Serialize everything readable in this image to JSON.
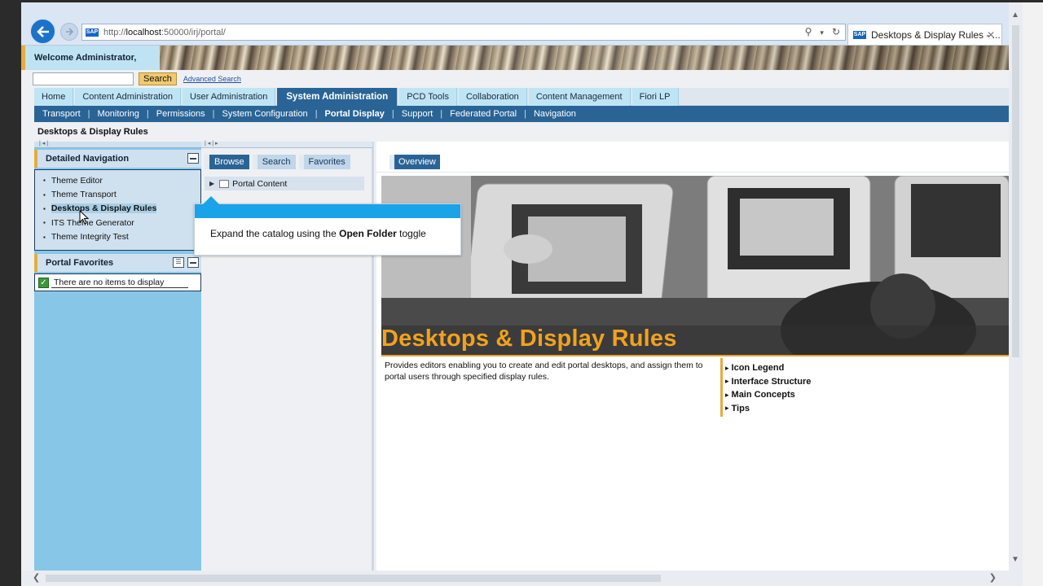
{
  "browser": {
    "url_prefix": "http://",
    "url_host": "localhost",
    "url_rest": ":50000/irj/portal/",
    "tab_title": "Desktops & Display Rules - ...",
    "favicon": "SAP"
  },
  "masthead": {
    "welcome": "Welcome Administrator,"
  },
  "search": {
    "value": "",
    "button": "Search",
    "advanced": "Advanced Search"
  },
  "topnav": [
    {
      "label": "Home",
      "active": false
    },
    {
      "label": "Content Administration",
      "active": false
    },
    {
      "label": "User Administration",
      "active": false
    },
    {
      "label": "System Administration",
      "active": true
    },
    {
      "label": "PCD Tools",
      "active": false
    },
    {
      "label": "Collaboration",
      "active": false
    },
    {
      "label": "Content Management",
      "active": false
    },
    {
      "label": "Fiori LP",
      "active": false
    }
  ],
  "subnav": [
    {
      "label": "Transport",
      "active": false
    },
    {
      "label": "Monitoring",
      "active": false
    },
    {
      "label": "Permissions",
      "active": false
    },
    {
      "label": "System Configuration",
      "active": false
    },
    {
      "label": "Portal Display",
      "active": true
    },
    {
      "label": "Support",
      "active": false
    },
    {
      "label": "Federated Portal",
      "active": false
    },
    {
      "label": "Navigation",
      "active": false
    }
  ],
  "page_title": "Desktops & Display Rules",
  "detailed_nav": {
    "title": "Detailed Navigation",
    "items": [
      {
        "label": "Theme Editor",
        "selected": false
      },
      {
        "label": "Theme Transport",
        "selected": false
      },
      {
        "label": "Desktops & Display Rules",
        "selected": true
      },
      {
        "label": "ITS Theme Generator",
        "selected": false
      },
      {
        "label": "Theme Integrity Test",
        "selected": false
      }
    ]
  },
  "favorites": {
    "title": "Portal Favorites",
    "empty": "There are no items to display"
  },
  "catalog": {
    "tabs": [
      {
        "label": "Browse",
        "active": true
      },
      {
        "label": "Search",
        "active": false
      },
      {
        "label": "Favorites",
        "active": false
      }
    ],
    "root": "Portal Content"
  },
  "overview": {
    "tab": "Overview",
    "hero_title": "Desktops & Display Rules",
    "description": "Provides editors enabling you to create and edit portal desktops, and assign them to portal users through specified display rules.",
    "links": [
      "Icon Legend",
      "Interface Structure",
      "Main Concepts",
      "Tips"
    ]
  },
  "callout": {
    "text_before": "Expand the catalog using the ",
    "text_bold": "Open Folder",
    "text_after": " toggle"
  },
  "colors": {
    "accent_orange": "#e6ac3e",
    "nav_blue": "#2a6496",
    "light_blue": "#88c6e8",
    "callout_blue": "#1aa3e8",
    "hero_title": "#f1a21f"
  }
}
